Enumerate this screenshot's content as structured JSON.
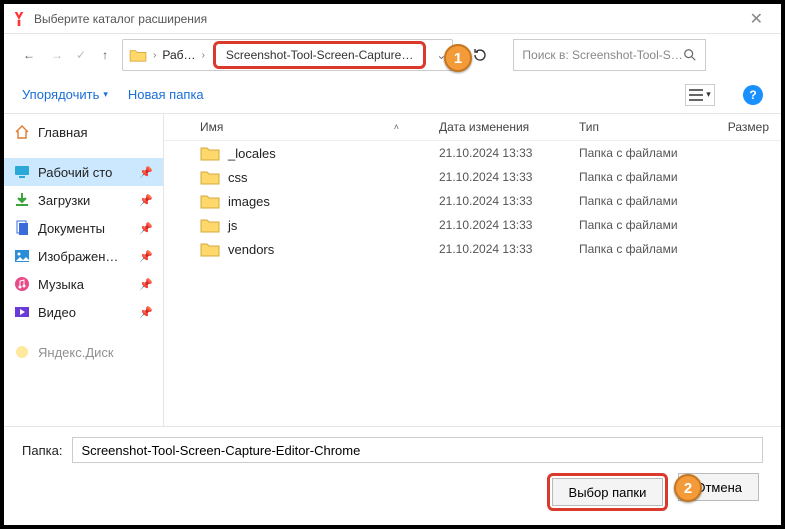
{
  "window": {
    "title": "Выберите каталог расширения"
  },
  "nav": {
    "segment1": "Раб…",
    "segment2": "Screenshot-Tool-Screen-Capture…"
  },
  "search": {
    "placeholder": "Поиск в: Screenshot-Tool-S…"
  },
  "toolbar": {
    "organize": "Упорядочить",
    "new_folder": "Новая папка"
  },
  "sidebar": {
    "home": "Главная",
    "desktop": "Рабочий сто",
    "downloads": "Загрузки",
    "documents": "Документы",
    "pictures": "Изображен…",
    "music": "Музыка",
    "video": "Видео",
    "yadisk": "Яндекс.Диск"
  },
  "columns": {
    "name": "Имя",
    "date": "Дата изменения",
    "type": "Тип",
    "size": "Размер"
  },
  "files": [
    {
      "name": "_locales",
      "date": "21.10.2024 13:33",
      "type": "Папка с файлами"
    },
    {
      "name": "css",
      "date": "21.10.2024 13:33",
      "type": "Папка с файлами"
    },
    {
      "name": "images",
      "date": "21.10.2024 13:33",
      "type": "Папка с файлами"
    },
    {
      "name": "js",
      "date": "21.10.2024 13:33",
      "type": "Папка с файлами"
    },
    {
      "name": "vendors",
      "date": "21.10.2024 13:33",
      "type": "Папка с файлами"
    }
  ],
  "footer": {
    "label": "Папка:",
    "value": "Screenshot-Tool-Screen-Capture-Editor-Chrome",
    "select": "Выбор папки",
    "cancel": "Отмена"
  },
  "badges": {
    "one": "1",
    "two": "2"
  }
}
